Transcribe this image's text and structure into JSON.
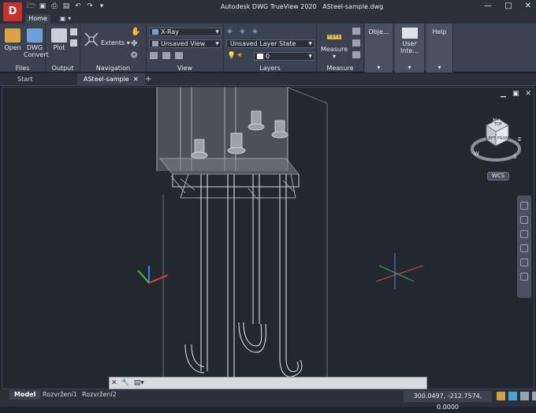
{
  "window": {
    "title": "Autodesk DWG TrueView 2020",
    "filename": "ASteel-sample.dwg",
    "minimize": "—",
    "maximize": "□",
    "close": "✕"
  },
  "logo": {
    "letter": "D",
    "color": "#c9302c"
  },
  "quick_access": [
    "folder-open-icon",
    "save-icon",
    "print-icon",
    "print-preview-icon",
    "undo-icon",
    "redo-icon",
    "more-icon"
  ],
  "ribbon_tabs": {
    "home": "Home",
    "extra": "▣ ▾"
  },
  "ribbon": {
    "files": {
      "label": "Files",
      "open": "Open",
      "dwg_convert_1": "DWG",
      "dwg_convert_2": "Convert"
    },
    "output": {
      "label": "Output",
      "plot": "Plot"
    },
    "navigation": {
      "label": "Navigation",
      "extents": "Extents"
    },
    "view": {
      "label": "View",
      "visual_style": "X-Ray",
      "named_view": "Unsaved View"
    },
    "layers": {
      "label": "Layers",
      "layer_state": "Unsaved Layer State",
      "current_layer": "0"
    },
    "measure": {
      "label": "Measure",
      "button": "Measure"
    },
    "objects": {
      "label": "Obje..."
    },
    "user_interface": {
      "label": "User Inte..."
    },
    "help": {
      "label": "Help"
    }
  },
  "file_tabs": {
    "start": "Start",
    "active": "ASteel-sample",
    "close": "✕",
    "add": "+"
  },
  "viewport_controls": {
    "minimize": "▁",
    "restore": "▣",
    "close": "✕"
  },
  "viewcube": {
    "top": "TOP",
    "left": "LEFT",
    "front": "FRONT",
    "n": "N",
    "w": "W",
    "s": "S",
    "e": "E",
    "wcs": "WCS"
  },
  "command_line": {
    "placeholder": ""
  },
  "layout_tabs": [
    "Model",
    "Rozvržení1",
    "Rozvržení2"
  ],
  "status": {
    "coordinates": "300.0497, -212.7574, 0.0000"
  },
  "colors": {
    "background": "#212830",
    "ribbon": "#3b4250",
    "accent": "#6da3d8",
    "axis_x": "#e04040",
    "axis_y": "#40c040",
    "axis_z": "#4080e0"
  }
}
